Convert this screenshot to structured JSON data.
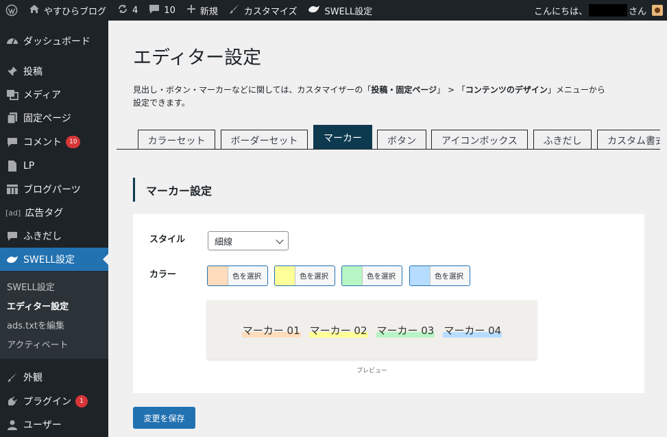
{
  "adminbar": {
    "site_name": "やすひらブログ",
    "updates_count": "4",
    "comments_count": "10",
    "new_label": "新規",
    "customize_label": "カスタマイズ",
    "swell_label": "SWELL設定",
    "greeting_prefix": "こんにちは、",
    "greeting_suffix": "さん"
  },
  "sidebar": {
    "items": [
      {
        "label": "ダッシュボード",
        "icon": "dashboard-icon"
      },
      {
        "label": "投稿",
        "icon": "pin-icon"
      },
      {
        "label": "メディア",
        "icon": "media-icon"
      },
      {
        "label": "固定ページ",
        "icon": "pages-icon"
      },
      {
        "label": "コメント",
        "icon": "comment-icon",
        "badge": "10"
      },
      {
        "label": "LP",
        "icon": "document-icon"
      },
      {
        "label": "ブログパーツ",
        "icon": "grid-icon"
      },
      {
        "label": "広告タグ",
        "icon": "ad-icon",
        "icon_text": "[ad]"
      },
      {
        "label": "ふきだし",
        "icon": "bubble-icon"
      },
      {
        "label": "SWELL設定",
        "icon": "swell-icon"
      },
      {
        "label": "外観",
        "icon": "brush-icon"
      },
      {
        "label": "プラグイン",
        "icon": "plugin-icon",
        "badge": "1"
      },
      {
        "label": "ユーザー",
        "icon": "user-icon"
      }
    ],
    "submenu": [
      "SWELL設定",
      "エディター設定",
      "ads.txtを編集",
      "アクティベート"
    ]
  },
  "main": {
    "title": "エディター設定",
    "intro_1": "見出し・ボタン・マーカーなどに関しては、カスタマイザーの「",
    "intro_b1": "投稿・固定ページ",
    "intro_2": "」 > 「",
    "intro_b2": "コンテンツのデザイン",
    "intro_3": "」メニューから",
    "intro_4": "設定できます。",
    "tabs": [
      "カラーセット",
      "ボーダーセット",
      "マーカー",
      "ボタン",
      "アイコンボックス",
      "ふきだし",
      "カスタム書式"
    ],
    "section_title": "マーカー設定",
    "style_label": "スタイル",
    "style_value": "細線",
    "color_label": "カラー",
    "color_button_label": "色を選択",
    "colors": [
      "#ffdcbc",
      "#ffff99",
      "#b8f5c4",
      "#b6ddff"
    ],
    "markers": [
      "マーカー 01",
      "マーカー 02",
      "マーカー 03",
      "マーカー 04"
    ],
    "preview_label": "プレビュー",
    "save_label": "変更を保存"
  }
}
